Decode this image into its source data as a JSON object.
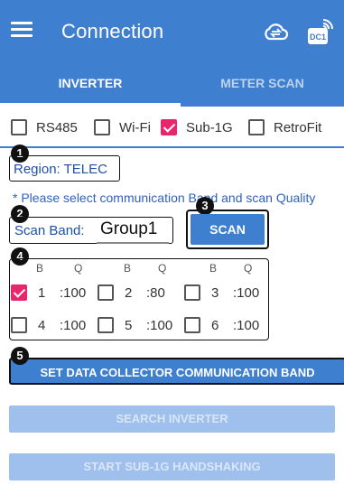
{
  "header": {
    "title": "Connection",
    "icons": [
      "menu-icon",
      "cloud-sync-icon",
      "data-collector-wifi-icon"
    ],
    "device_label": "DC1"
  },
  "tabs": [
    {
      "label": "INVERTER",
      "active": true
    },
    {
      "label": "METER SCAN",
      "active": false
    }
  ],
  "modes": [
    {
      "label": "RS485",
      "checked": false
    },
    {
      "label": "Wi-Fi",
      "checked": false
    },
    {
      "label": "Sub-1G",
      "checked": true
    },
    {
      "label": "RetroFit",
      "checked": false
    }
  ],
  "steps": [
    "1",
    "2",
    "3",
    "4",
    "5"
  ],
  "region": {
    "label": "Region:",
    "value": "TELEC"
  },
  "hint": "* Please select communication Band and scan Quality",
  "scan_band": {
    "label": "Scan Band:",
    "value": "Group1",
    "button": "SCAN"
  },
  "band_table": {
    "headers": [
      "B",
      "Q",
      "B",
      "Q",
      "B",
      "Q"
    ],
    "bands": [
      {
        "band": "1",
        "quality": ":100",
        "checked": true
      },
      {
        "band": "2",
        "quality": ":80",
        "checked": false
      },
      {
        "band": "3",
        "quality": ":100",
        "checked": false
      },
      {
        "band": "4",
        "quality": ":100",
        "checked": false
      },
      {
        "band": "5",
        "quality": ":100",
        "checked": false
      },
      {
        "band": "6",
        "quality": ":100",
        "checked": false
      }
    ]
  },
  "buttons": {
    "set_band": "SET DATA COLLECTOR COMMUNICATION BAND",
    "search_inverter": "SEARCH INVERTER",
    "start_handshaking": "START SUB-1G HANDSHAKING"
  },
  "colors": {
    "primary": "#3f7fcf",
    "accent": "#e8266e",
    "disabled": "#9fc0ec"
  }
}
